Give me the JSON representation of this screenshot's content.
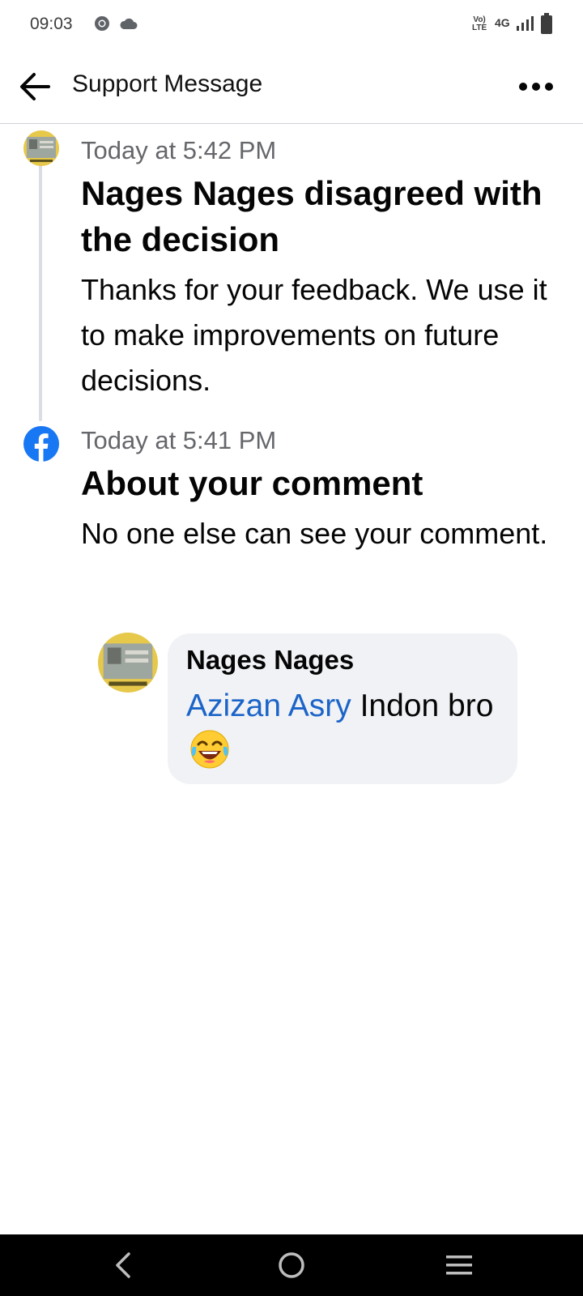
{
  "status_bar": {
    "time": "09:03",
    "volte_label_top": "Vo)",
    "volte_label_bottom": "LTE",
    "network": "4G",
    "icons": [
      "chrome-icon",
      "cloud-icon",
      "signal-icon",
      "battery-icon"
    ]
  },
  "header": {
    "title": "Support Message",
    "back_icon": "arrow-left-icon",
    "more_icon": "more-horizontal-icon"
  },
  "timeline": [
    {
      "timestamp": "Today at 5:42 PM",
      "title": "Nages Nages disagreed with the decision",
      "body": "Thanks for your feedback. We use it to make improvements on future decisions.",
      "icon": "user-avatar"
    },
    {
      "timestamp": "Today at 5:41 PM",
      "title": "About your comment",
      "body": "No one else can see your comment.",
      "icon": "facebook-icon"
    }
  ],
  "comment": {
    "author": "Nages Nages",
    "mention": "Azizan Asry",
    "text": " Indon bro",
    "emoji": "face-with-tears-of-joy"
  },
  "nav_bar": {
    "icons": [
      "nav-back-icon",
      "nav-home-icon",
      "nav-recents-icon"
    ]
  },
  "colors": {
    "accent_blue": "#1877f2",
    "mention_blue": "#1b64c8",
    "bubble_bg": "#f0f2f5",
    "timestamp_gray": "#65676b"
  }
}
